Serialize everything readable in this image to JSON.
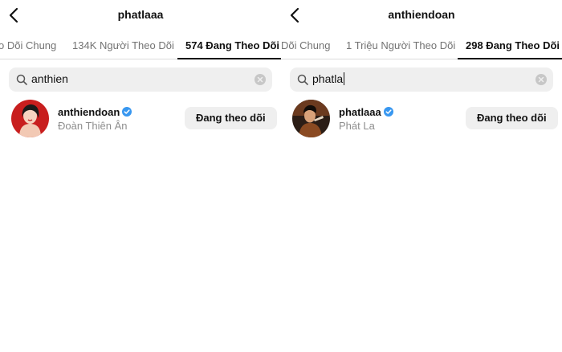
{
  "colors": {
    "verified": "#3897f0",
    "tab_active": "#111111",
    "tab_inactive": "#737373",
    "button_bg": "#efefef",
    "search_bg": "#efefef"
  },
  "panels": [
    {
      "title": "phatlaaa",
      "tabs": [
        {
          "label": "o Dõi Chung",
          "active": false
        },
        {
          "label": "134K Người Theo Dõi",
          "active": false
        },
        {
          "label": "574 Đang Theo Dõi",
          "active": true
        }
      ],
      "search": {
        "value": "anthien",
        "icon": "search-icon",
        "clear_icon": "clear-icon"
      },
      "result": {
        "username": "anthiendoan",
        "full_name": "Đoàn Thiên Ân",
        "verified": true,
        "button_label": "Đang theo dõi"
      }
    },
    {
      "title": "anthiendoan",
      "tabs": [
        {
          "label": "Dõi Chung",
          "active": false
        },
        {
          "label": "1 Triệu Người Theo Dõi",
          "active": false
        },
        {
          "label": "298 Đang Theo Dõi",
          "active": true
        }
      ],
      "search": {
        "value": "phatla",
        "icon": "search-icon",
        "clear_icon": "clear-icon"
      },
      "result": {
        "username": "phatlaaa",
        "full_name": "Phát La",
        "verified": true,
        "button_label": "Đang theo dõi"
      }
    }
  ]
}
